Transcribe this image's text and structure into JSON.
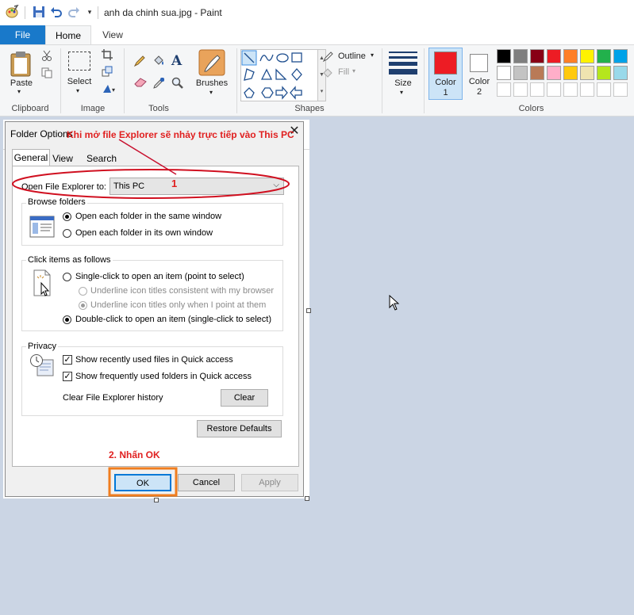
{
  "window": {
    "title": "anh da chinh sua.jpg - Paint"
  },
  "tabs": {
    "file": "File",
    "home": "Home",
    "view": "View"
  },
  "ribbon": {
    "clipboard": {
      "paste": "Paste",
      "label": "Clipboard"
    },
    "image": {
      "select": "Select",
      "label": "Image"
    },
    "tools": {
      "label": "Tools"
    },
    "brushes": {
      "label": "Brushes"
    },
    "shapes": {
      "outline": "Outline",
      "fill": "Fill",
      "label": "Shapes"
    },
    "size": {
      "label": "Size"
    },
    "colors": {
      "color1_l1": "Color",
      "color1_l2": "1",
      "color2_l1": "Color",
      "color2_l2": "2",
      "label": "Colors",
      "color1_value": "#ed1c24",
      "color2_value": "#ffffff",
      "palette_row1": [
        "#000000",
        "#7f7f7f",
        "#880015",
        "#ed1c24",
        "#ff7f27",
        "#fff200",
        "#22b14c",
        "#00a2e8"
      ],
      "palette_row2": [
        "#ffffff",
        "#c3c3c3",
        "#b97a57",
        "#ffaec9",
        "#ffc90e",
        "#efe4b0",
        "#b5e61d",
        "#99d9ea"
      ]
    }
  },
  "dialog": {
    "title": "Folder Options",
    "close": "✕",
    "tabs": {
      "general": "General",
      "view": "View",
      "search": "Search"
    },
    "open_label": "Open File Explorer to:",
    "open_value": "This PC",
    "browse": {
      "label": "Browse folders",
      "opt1": "Open each folder in the same window",
      "opt2": "Open each folder in its own window"
    },
    "click": {
      "label": "Click items as follows",
      "opt1": "Single-click to open an item (point to select)",
      "sub1": "Underline icon titles consistent with my browser",
      "sub2": "Underline icon titles only when I point at them",
      "opt2": "Double-click to open an item (single-click to select)"
    },
    "privacy": {
      "label": "Privacy",
      "cb1": "Show recently used files in Quick access",
      "cb2": "Show frequently used folders in Quick access",
      "clear_label": "Clear File Explorer history",
      "clear_btn": "Clear"
    },
    "restore": "Restore Defaults",
    "ok": "OK",
    "cancel": "Cancel",
    "apply": "Apply"
  },
  "annotations": {
    "note1": "Khi mở file Explorer sẽ nhảy trực tiếp vào This PC",
    "num1": "1",
    "note2": "2. Nhấn OK"
  }
}
